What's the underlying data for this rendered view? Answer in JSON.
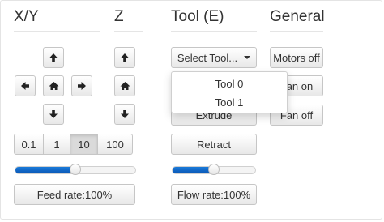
{
  "headers": {
    "xy": "X/Y",
    "z": "Z",
    "tool": "Tool (E)",
    "general": "General"
  },
  "xy": {
    "steps": [
      "0.1",
      "1",
      "10",
      "100"
    ],
    "active_step": "10",
    "feed_rate_label": "Feed rate:100%",
    "feed_rate_percent": 100,
    "feed_slider_fraction": 0.5
  },
  "z": {},
  "tool": {
    "select_label": "Select Tool...",
    "options": [
      "Tool 0",
      "Tool 1"
    ],
    "extrude_label": "Extrude",
    "retract_label": "Retract",
    "flow_rate_label": "Flow rate:100%",
    "flow_rate_percent": 100,
    "flow_slider_fraction": 0.5
  },
  "general": {
    "motors_off_label": "Motors off",
    "fan_on_label": "Fan on",
    "fan_off_label": "Fan off"
  },
  "icons": {
    "up": "arrow-up-icon",
    "down": "arrow-down-icon",
    "left": "arrow-left-icon",
    "right": "arrow-right-icon",
    "home": "home-icon"
  },
  "colors": {
    "slider_fill": "#0a57b6",
    "border": "#c6c6c6"
  }
}
